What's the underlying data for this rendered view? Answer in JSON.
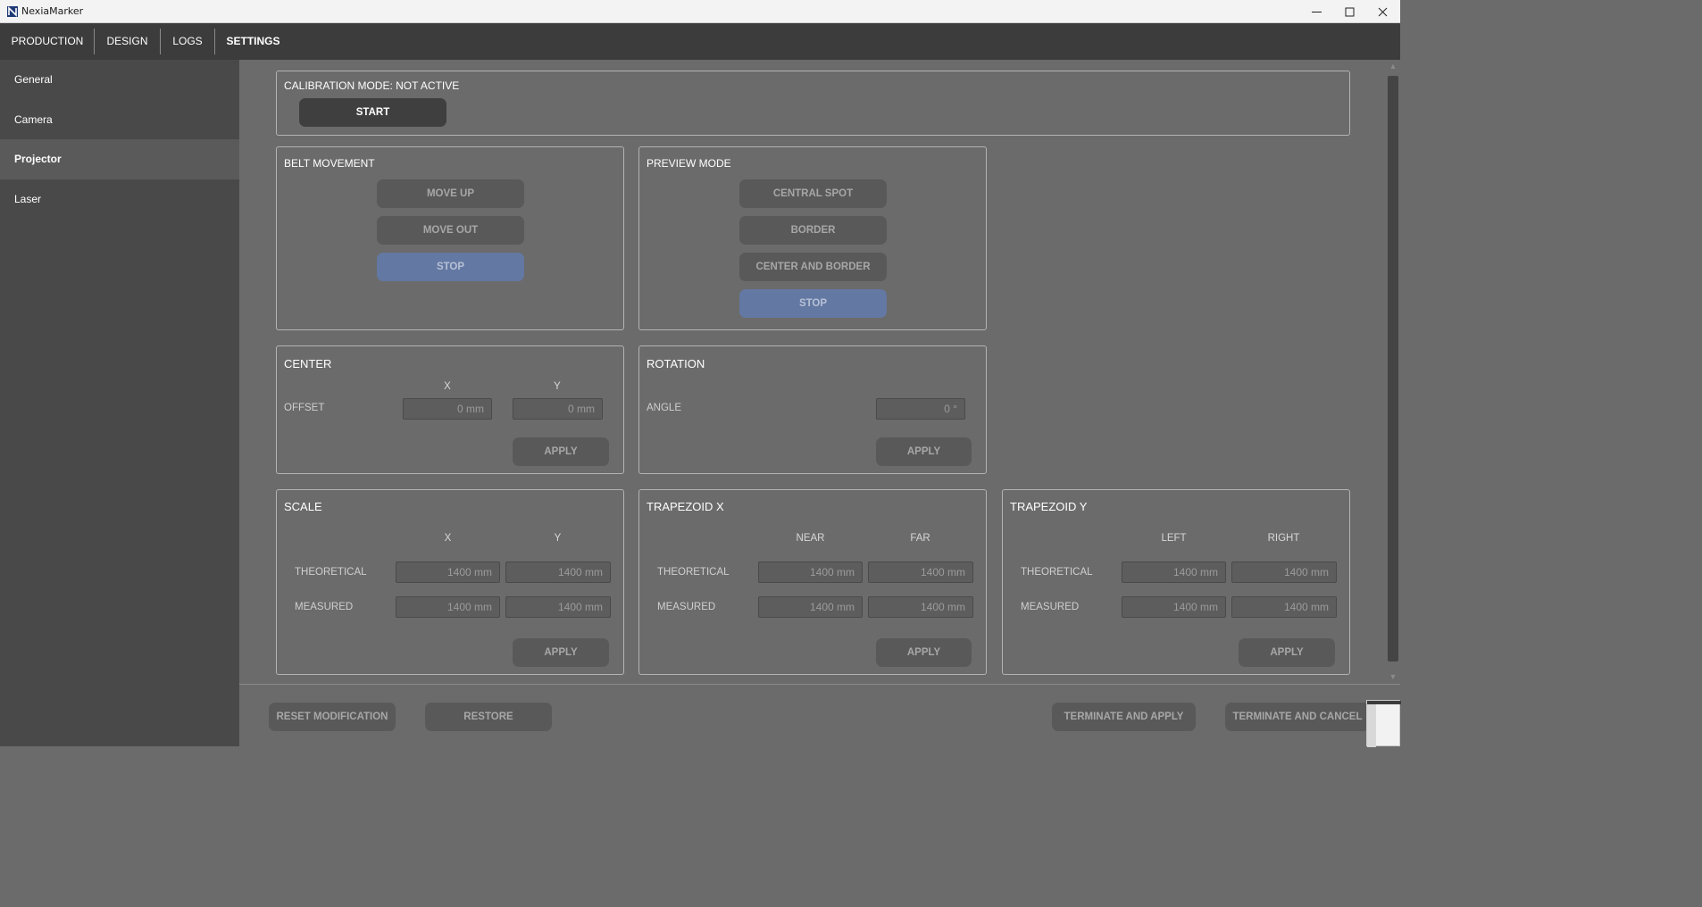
{
  "window": {
    "title": "NexiaMarker"
  },
  "nav": {
    "tabs": [
      {
        "label": "PRODUCTION"
      },
      {
        "label": "DESIGN"
      },
      {
        "label": "LOGS"
      },
      {
        "label": "SETTINGS",
        "active": true
      }
    ]
  },
  "sidebar": {
    "items": [
      {
        "label": "General"
      },
      {
        "label": "Camera"
      },
      {
        "label": "Projector",
        "active": true
      },
      {
        "label": "Laser"
      }
    ]
  },
  "calibration": {
    "status": "CALIBRATION MODE: NOT ACTIVE",
    "start_label": "START"
  },
  "belt_movement": {
    "title": "BELT MOVEMENT",
    "move_up": "MOVE UP",
    "move_out": "MOVE OUT",
    "stop": "STOP"
  },
  "preview_mode": {
    "title": "PREVIEW MODE",
    "central_spot": "CENTRAL SPOT",
    "border": "BORDER",
    "center_and_border": "CENTER AND BORDER",
    "stop": "STOP"
  },
  "center": {
    "title": "CENTER",
    "col_x": "X",
    "col_y": "Y",
    "row_label": "OFFSET",
    "x_value": "0 mm",
    "y_value": "0 mm",
    "apply": "APPLY"
  },
  "rotation": {
    "title": "ROTATION",
    "row_label": "ANGLE",
    "value": "0 °",
    "apply": "APPLY"
  },
  "scale": {
    "title": "SCALE",
    "col1": "X",
    "col2": "Y",
    "row1": "THEORETICAL",
    "row2": "MEASURED",
    "theoretical_1": "1400 mm",
    "theoretical_2": "1400 mm",
    "measured_1": "1400 mm",
    "measured_2": "1400 mm",
    "apply": "APPLY"
  },
  "trapezoid_x": {
    "title": "TRAPEZOID X",
    "col1": "NEAR",
    "col2": "FAR",
    "row1": "THEORETICAL",
    "row2": "MEASURED",
    "theoretical_1": "1400 mm",
    "theoretical_2": "1400 mm",
    "measured_1": "1400 mm",
    "measured_2": "1400 mm",
    "apply": "APPLY"
  },
  "trapezoid_y": {
    "title": "TRAPEZOID Y",
    "col1": "LEFT",
    "col2": "RIGHT",
    "row1": "THEORETICAL",
    "row2": "MEASURED",
    "theoretical_1": "1400 mm",
    "theoretical_2": "1400 mm",
    "measured_1": "1400 mm",
    "measured_2": "1400 mm",
    "apply": "APPLY"
  },
  "footer": {
    "reset_modification": "RESET MODIFICATION",
    "restore": "RESTORE",
    "terminate_and_apply": "TERMINATE AND APPLY",
    "terminate_and_cancel": "TERMINATE AND CANCEL"
  },
  "colors": {
    "active_stop": "#6378a2",
    "nav_bg": "#3c3c3c",
    "sidebar_bg": "#494949",
    "content_bg": "#6b6b6b"
  }
}
